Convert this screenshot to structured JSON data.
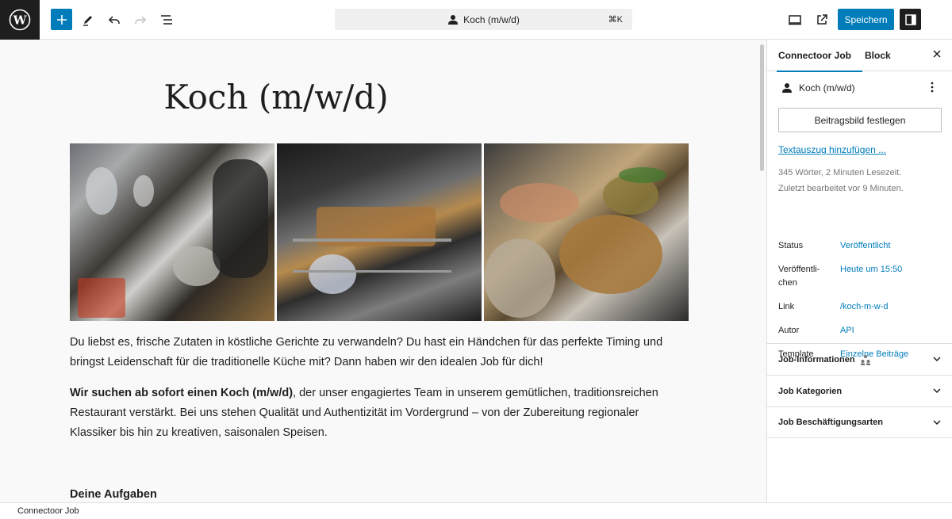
{
  "topbar": {
    "document_title": "Koch (m/w/d)",
    "shortcut": "⌘K",
    "save_label": "Speichern"
  },
  "post": {
    "title": "Koch (m/w/d)",
    "paragraph1": "Du liebst es, frische Zutaten in köstliche Gerichte zu verwandeln? Du hast ein Händchen für das perfekte Timing und bringst Leidenschaft für die traditionelle Küche mit? Dann haben wir den idealen Job für dich!",
    "paragraph2_bold": "Wir suchen ab sofort einen Koch (m/w/d)",
    "paragraph2_rest": ", der unser engagiertes Team in unserem gemütlichen, traditionsreichen Restaurant verstärkt. Bei uns stehen Qualität und Authentizität im Vordergrund – von der Zubereitung regionaler Klassiker bis hin zu kreativen, saisonalen Speisen.",
    "heading_tasks": "Deine Aufgaben"
  },
  "sidebar": {
    "tab_post": "Connectoor Job",
    "tab_block": "Block",
    "post_name": "Koch (m/w/d)",
    "featured_image_label": "Beitragsbild festlegen",
    "excerpt_link": "Textauszug hinzufügen ...",
    "word_count": "345 Wörter, 2 Minuten Lesezeit.",
    "last_edited": "Zuletzt bearbeitet vor 9 Minuten.",
    "properties": [
      {
        "label": "Status",
        "value": "Veröffentlicht"
      },
      {
        "label": "Veröffentli-chen",
        "value": "Heute um 15:50"
      },
      {
        "label": "Link",
        "value": "/koch-m-w-d"
      },
      {
        "label": "Autor",
        "value": "API"
      },
      {
        "label": "Template",
        "value": "Einzelne Beiträge"
      }
    ],
    "panels": [
      {
        "label": "Job-Informationen"
      },
      {
        "label": "Job Kategorien"
      },
      {
        "label": "Job Beschäftigungsarten"
      }
    ]
  },
  "footer": {
    "breadcrumb": "Connectoor Job"
  },
  "colors": {
    "accent": "#007cba",
    "dark": "#1e1e1e"
  }
}
